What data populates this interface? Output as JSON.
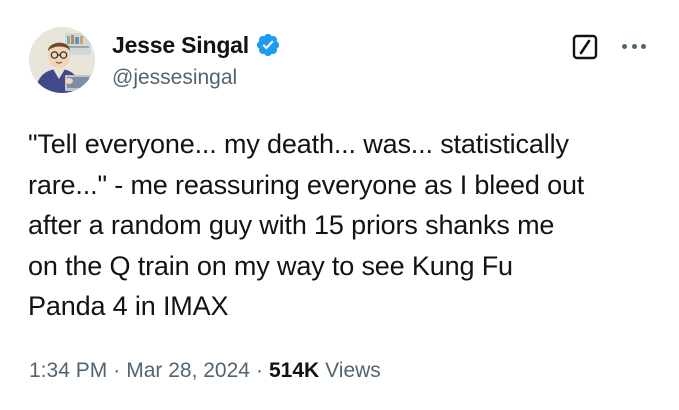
{
  "author": {
    "display_name": "Jesse Singal",
    "handle": "@jessesingal",
    "verified": true,
    "verified_color": "#1d9bf0"
  },
  "actions": {
    "grok_icon": "grok-slash-icon",
    "more_icon": "more-horizontal-icon"
  },
  "tweet": {
    "text": "\"Tell everyone... my death... was... statistically\nrare...\" - me reassuring everyone as I bleed out\nafter a random guy with 15 priors shanks me\non the Q train on my way to see Kung Fu\nPanda 4 in IMAX"
  },
  "meta": {
    "time": "1:34 PM",
    "separator": "·",
    "date": "Mar 28, 2024",
    "views_count": "514K",
    "views_label": "Views"
  },
  "colors": {
    "text_primary": "#0f1419",
    "text_secondary": "#536471",
    "background": "#ffffff"
  }
}
